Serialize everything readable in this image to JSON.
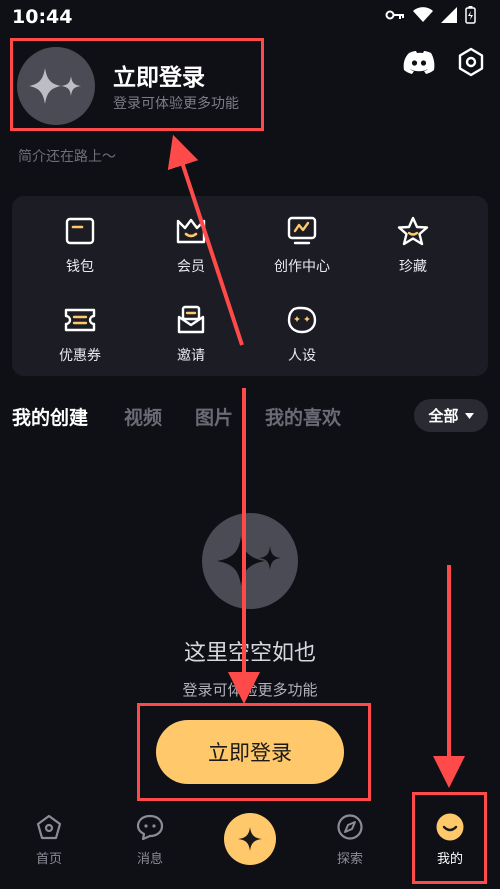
{
  "status_bar": {
    "time": "10:44"
  },
  "profile": {
    "login_title": "立即登录",
    "login_subtitle": "登录可体验更多功能",
    "bio": "简介还在路上～"
  },
  "grid": [
    {
      "label": "钱包",
      "icon": "wallet-icon"
    },
    {
      "label": "会员",
      "icon": "crown-icon"
    },
    {
      "label": "创作中心",
      "icon": "creator-center-icon"
    },
    {
      "label": "珍藏",
      "icon": "star-icon"
    },
    {
      "label": "优惠券",
      "icon": "coupon-icon"
    },
    {
      "label": "邀请",
      "icon": "invite-icon"
    },
    {
      "label": "人设",
      "icon": "persona-icon"
    }
  ],
  "tabs": [
    {
      "label": "我的创建",
      "active": true
    },
    {
      "label": "视频",
      "active": false
    },
    {
      "label": "图片",
      "active": false
    },
    {
      "label": "我的喜欢",
      "active": false
    }
  ],
  "filter": {
    "label": "全部"
  },
  "empty_state": {
    "title": "这里空空如也",
    "subtitle": "登录可体验更多功能",
    "button": "立即登录"
  },
  "bottom_nav": [
    {
      "label": "首页",
      "icon": "home-icon",
      "active": false
    },
    {
      "label": "消息",
      "icon": "message-icon",
      "active": false
    },
    {
      "label": "",
      "icon": "sparkle-create-icon",
      "active": false
    },
    {
      "label": "探索",
      "icon": "compass-icon",
      "active": false
    },
    {
      "label": "我的",
      "icon": "profile-smile-icon",
      "active": true
    }
  ],
  "colors": {
    "accent": "#ffc96b",
    "background": "#0f0f16",
    "annotation": "#ff4a4a"
  }
}
